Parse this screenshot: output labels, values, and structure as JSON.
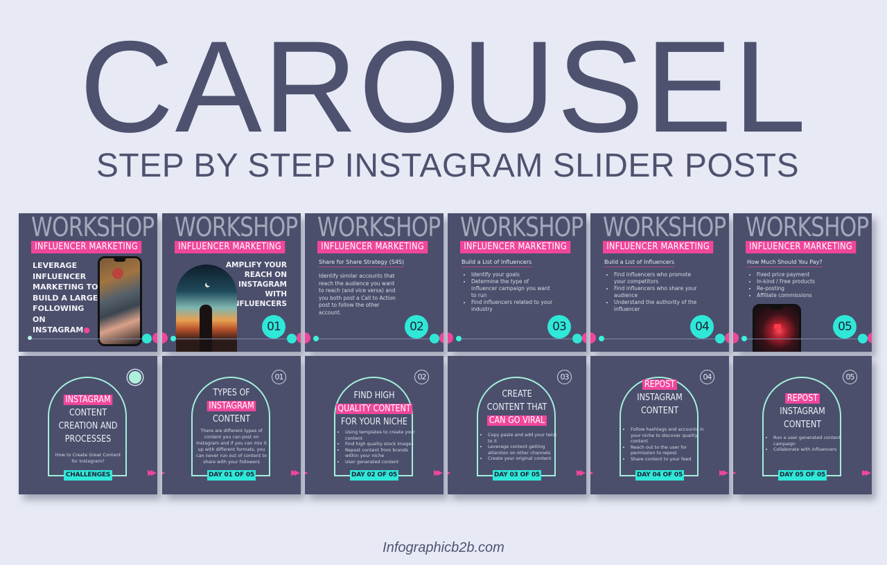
{
  "header": {
    "title": "CAROUSEL",
    "subtitle": "STEP BY STEP INSTAGRAM SLIDER POSTS"
  },
  "footer": {
    "credit": "Infographicb2b.com"
  },
  "colors": {
    "background": "#e7eaf5",
    "title_text": "#4e526f",
    "card_bg": "#4b4f6c",
    "accent_pink": "#f0469b",
    "accent_teal": "#2fe8d8",
    "arch_outline": "#a4f0dc"
  },
  "top_row": {
    "workshop_label": "WORKSHOP",
    "banner_label": "INFLUENCER MARKETING",
    "cards": [
      {
        "headline": "LEVERAGE INFLUENCER MARKETING TO BUILD A LARGE FOLLOWING ON INSTAGRAM",
        "image": "phone-photo-holding-hands"
      },
      {
        "headline": "AMPLIFY YOUR REACH ON INSTAGRAM WITH INFLUENCERS",
        "number": "01",
        "image": "arch-photo-silhouette-moon"
      },
      {
        "subheading": "Share for Share Strategy (S4S)",
        "body": "Identify similar accounts that reach the audience you want to reach (and vice versa) and you both post a Call to Action post to follow the other account.",
        "number": "02"
      },
      {
        "subheading": "Build a List of Influencers",
        "bullets": [
          "Identify your goals",
          "Determine the type of influencer campaign you want to run",
          "Find influencers related to your industry"
        ],
        "number": "03"
      },
      {
        "subheading": "Build a List of Influencers",
        "bullets": [
          "Find influencers who promote your competitors",
          "Find influencers who share your audience",
          "Understand the authority of the influencer"
        ],
        "number": "04"
      },
      {
        "subheading": "How Much Should You Pay?",
        "bullets": [
          "Fixed price payment",
          "In-kind / Free products",
          "Re-posting",
          "Affiliate commissions"
        ],
        "number": "05",
        "image": "phone-photo-like-notification"
      }
    ]
  },
  "bottom_row": {
    "cards": [
      {
        "title_highlight": "INSTAGRAM",
        "title_rest": [
          "CONTENT",
          "CREATION AND",
          "PROCESSES"
        ],
        "body": "How to Create Great Content for Instagram?",
        "tag": "CHALLENGES"
      },
      {
        "number": "01",
        "title_pre": [
          "TYPES OF"
        ],
        "title_highlight": "INSTAGRAM",
        "title_post": [
          "CONTENT"
        ],
        "body": "There are different types of content you can post on Instagram and if you can mix it up with different formats, you can never run out of content to share with your followers",
        "tag": "DAY 01 OF 05"
      },
      {
        "number": "02",
        "title_pre": [
          "FIND HIGH"
        ],
        "title_highlight": "QUALITY CONTENT",
        "title_post": [
          "FOR YOUR NICHE"
        ],
        "bullets": [
          "Using templates to create your content",
          "Find high quality stock images",
          "Repost content from brands within your niche",
          "User generated content"
        ],
        "tag": "DAY 02 OF 05"
      },
      {
        "number": "03",
        "title_pre": [
          "CREATE",
          "CONTENT THAT"
        ],
        "title_highlight": "CAN GO VIRAL",
        "title_post": [],
        "bullets": [
          "Copy paste and add your twist to it",
          "Leverage content getting attention on other channels",
          "Create your original content"
        ],
        "tag": "DAY 03 OF 05"
      },
      {
        "number": "04",
        "title_pre": [],
        "title_highlight": "REPOST",
        "title_post": [
          "INSTAGRAM",
          "CONTENT"
        ],
        "bullets": [
          "Follow hashtags and accounts in your niche to discover quality content",
          "Reach out to the user for permission to repost",
          "Share content to your feed"
        ],
        "tag": "DAY 04 OF 05"
      },
      {
        "number": "05",
        "title_pre": [],
        "title_highlight": "REPOST",
        "title_post": [
          "INSTAGRAM",
          "CONTENT"
        ],
        "bullets": [
          "Run a user generated content campaign",
          "Collaborate with influencers"
        ],
        "tag": "DAY 05 OF 05"
      }
    ],
    "arrow_icon": "double-arrow-right-icon"
  }
}
